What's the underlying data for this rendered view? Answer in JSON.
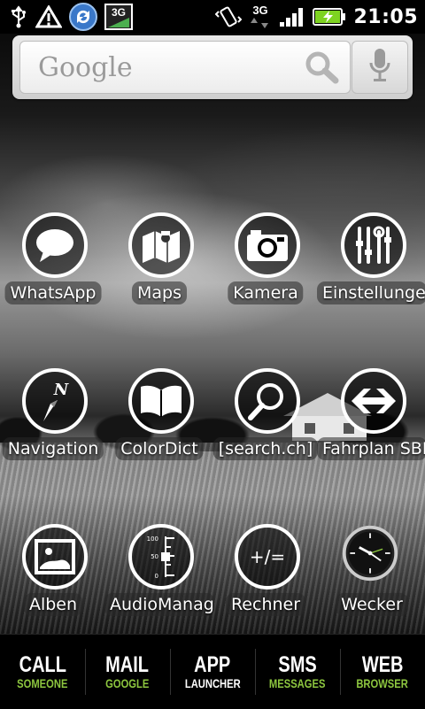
{
  "status_bar": {
    "time": "21:05",
    "network": "3G",
    "icons": [
      "usb-icon",
      "warning-icon",
      "sync-icon",
      "3g-network-icon",
      "vibrate-icon",
      "3g-data-icon",
      "signal-icon",
      "battery-charging-icon"
    ]
  },
  "search": {
    "placeholder": "Google"
  },
  "apps": [
    {
      "label": "WhatsApp",
      "icon": "chat-bubble-icon"
    },
    {
      "label": "Maps",
      "icon": "map-icon"
    },
    {
      "label": "Kamera",
      "icon": "camera-icon"
    },
    {
      "label": "Einstellungen",
      "icon": "settings-tools-icon"
    },
    {
      "label": "Navigation",
      "icon": "compass-icon"
    },
    {
      "label": "ColorDict",
      "icon": "book-icon"
    },
    {
      "label": "[search.ch]",
      "icon": "magnifier-icon"
    },
    {
      "label": "Fahrplan SBB",
      "icon": "sbb-arrows-icon"
    },
    {
      "label": "Alben",
      "icon": "photo-icon"
    },
    {
      "label": "AudioManager",
      "icon": "audio-slider-icon"
    },
    {
      "label": "Rechner",
      "icon": "calculator-icon"
    },
    {
      "label": "Wecker",
      "icon": "clock-icon"
    }
  ],
  "dock": [
    {
      "main": "CALL",
      "sub": "SOMEONE",
      "sub_color": "#8dc63f"
    },
    {
      "main": "MAIL",
      "sub": "GOOGLE",
      "sub_color": "#8dc63f"
    },
    {
      "main": "APP",
      "sub": "LAUNCHER",
      "sub_color": "#ffffff"
    },
    {
      "main": "SMS",
      "sub": "MESSAGES",
      "sub_color": "#8dc63f"
    },
    {
      "main": "WEB",
      "sub": "BROWSER",
      "sub_color": "#8dc63f"
    }
  ],
  "colors": {
    "accent_green": "#8dc63f",
    "battery_green": "#7ed321"
  }
}
